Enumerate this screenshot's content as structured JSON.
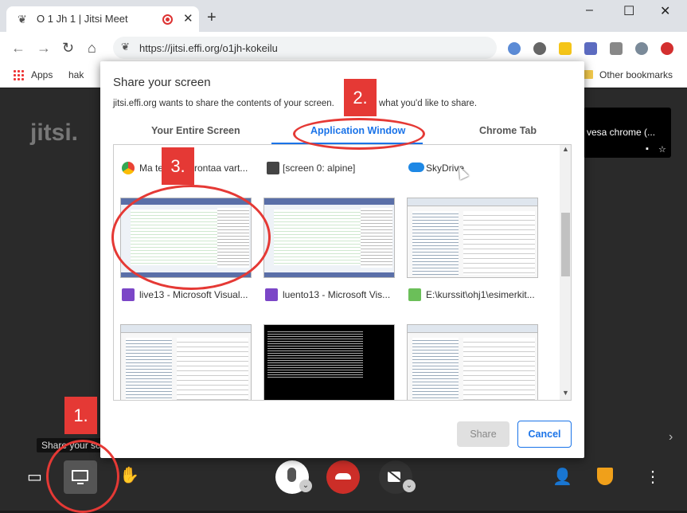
{
  "browser": {
    "tab_title": "O 1 Jh 1 | Jitsi Meet",
    "new_tab_glyph": "+",
    "url": "https://jitsi.effi.org/o1jh-kokeilu",
    "window_controls": [
      "–",
      "☐",
      "✕"
    ],
    "bookmarks": {
      "apps": "Apps",
      "hak": "hak",
      "other": "Other bookmarks"
    }
  },
  "meeting": {
    "logo": "jitsi.",
    "participant_name": "vesa chrome (...",
    "tooltip": "Share your sc"
  },
  "dialog": {
    "title": "Share your screen",
    "subtitle_a": "jitsi.effi.org wants to share the contents of your screen.",
    "subtitle_b": "what you'd like to share.",
    "tabs": [
      "Your Entire Screen",
      "Application Window",
      "Chrome Tab"
    ],
    "items": [
      {
        "label": "Ma te",
        "label2": "rontaa vart...",
        "icon": "chrome-icon"
      },
      {
        "label": "[screen 0: alpine]",
        "icon": "terminal-icon"
      },
      {
        "label": "SkyDrive",
        "icon": "onedrive-icon"
      },
      {
        "label": "live13 - Microsoft Visual...",
        "icon": "visual-studio-icon"
      },
      {
        "label": "luento13 - Microsoft Vis...",
        "icon": "visual-studio-icon"
      },
      {
        "label": "E:\\kurssit\\ohj1\\esimerkit...",
        "icon": "notepad-icon"
      }
    ],
    "share_label": "Share",
    "cancel_label": "Cancel"
  },
  "annotations": {
    "step1": "1.",
    "step2": "2.",
    "step3": "3."
  },
  "colors": {
    "accent": "#1a73e8",
    "annotation": "#e53935",
    "hangup": "#cc2e28"
  }
}
